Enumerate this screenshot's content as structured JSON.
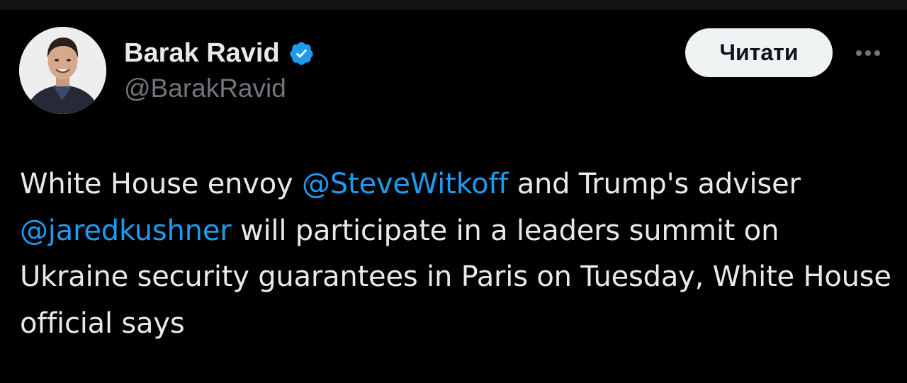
{
  "author": {
    "display_name": "Barak Ravid",
    "handle": "@BarakRavid",
    "verified": true,
    "avatar_icon": "avatar-photo"
  },
  "actions": {
    "follow_label": "Читати",
    "more_icon": "more-dots-icon"
  },
  "tweet": {
    "segments": {
      "t1": "White House envoy ",
      "m1": "@SteveWitkoff",
      "t2": " and Trump's adviser ",
      "m2": "@jaredkushner",
      "t3": " will participate in a leaders summit on Ukraine security guarantees in Paris on Tuesday, White House official says"
    }
  },
  "colors": {
    "background": "#000000",
    "text": "#e7e9ea",
    "secondary": "#71767b",
    "link": "#1d9bf0",
    "verified_badge": "#1d9bf0",
    "button_bg": "#eff3f4"
  }
}
